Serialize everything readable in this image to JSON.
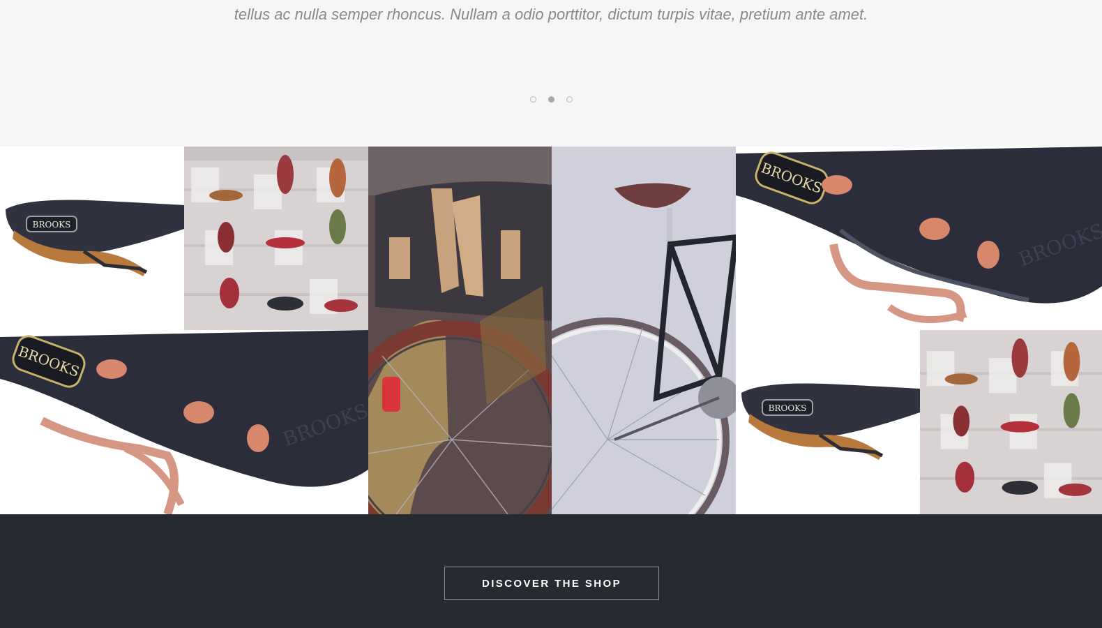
{
  "testimonial": {
    "quote_text": "tellus ac nulla semper rhoncus. Nullam a odio porttitor, dictum turpis vitae, pretium ante amet.",
    "slides": [
      {
        "label": "slide-1",
        "active": false
      },
      {
        "label": "slide-2",
        "active": true
      },
      {
        "label": "slide-3",
        "active": false
      }
    ]
  },
  "gallery": {
    "images": [
      {
        "name": "saddle-side-black",
        "text": "BROOKS"
      },
      {
        "name": "saddle-wall-display"
      },
      {
        "name": "bike-rear-bag"
      },
      {
        "name": "road-bike-grey"
      },
      {
        "name": "saddle-closeup-copper",
        "text": "BROOKS"
      },
      {
        "name": "saddle-closeup-copper-2",
        "text": "BROOKS"
      },
      {
        "name": "saddle-side-black-2",
        "text": "BROOKS"
      },
      {
        "name": "saddle-wall-display-2"
      }
    ]
  },
  "footer": {
    "cta_label": "DISCOVER THE SHOP"
  },
  "colors": {
    "page_bg": "#f7f5f5",
    "footer_bg": "#262b32",
    "text_grey": "#8a8a8a",
    "dot_active": "#a9a9a9"
  }
}
